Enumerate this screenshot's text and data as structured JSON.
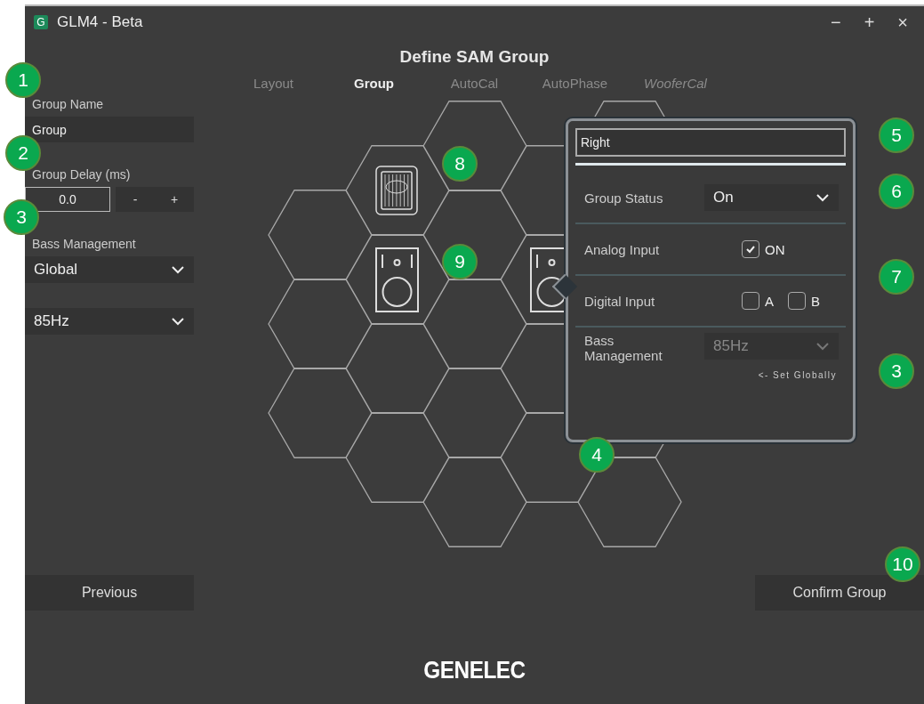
{
  "window": {
    "app_icon": "G",
    "title": "GLM4 - Beta",
    "controls": [
      "−",
      "+",
      "×"
    ]
  },
  "heading": "Define SAM Group",
  "tabs": [
    {
      "label": "Layout",
      "selected": false,
      "kind": "step"
    },
    {
      "label": "Group",
      "selected": true,
      "kind": "step"
    },
    {
      "label": "AutoCal",
      "selected": false,
      "kind": "step"
    },
    {
      "label": "AutoPhase",
      "selected": false,
      "kind": "step"
    },
    {
      "label": "WooferCal",
      "selected": false,
      "kind": "optional"
    }
  ],
  "sidebar": {
    "fields": [
      {
        "kind": "text",
        "label": "Group Name",
        "value": "Group"
      },
      {
        "kind": "stepper",
        "label": "Group Delay (ms)",
        "value": "0.0",
        "buttons": [
          "-",
          "+"
        ]
      },
      {
        "kind": "dropdown",
        "label": "Bass Management",
        "value": "Global"
      },
      {
        "kind": "dropdown",
        "value": "85Hz"
      }
    ]
  },
  "popup": {
    "name": "Right",
    "rows": [
      {
        "kind": "dropdown",
        "label": "Group Status",
        "value": "On",
        "disabled": false
      },
      {
        "kind": "checkboxes",
        "label": "Analog Input",
        "options": [
          {
            "label": "ON",
            "checked": true
          }
        ]
      },
      {
        "kind": "checkboxes",
        "label": "Digital Input",
        "options": [
          {
            "label": "A",
            "checked": false
          },
          {
            "label": "B",
            "checked": false
          }
        ]
      },
      {
        "kind": "dropdown",
        "label": "Bass Management",
        "value": "85Hz",
        "disabled": true,
        "hint": "<- Set Globally"
      }
    ]
  },
  "buttons": {
    "previous": "Previous",
    "confirm": "Confirm Group"
  },
  "logo": "GENELEC",
  "callouts": [
    "1",
    "2",
    "3",
    "8",
    "9",
    "5",
    "6",
    "7",
    "3",
    "4",
    "10"
  ]
}
